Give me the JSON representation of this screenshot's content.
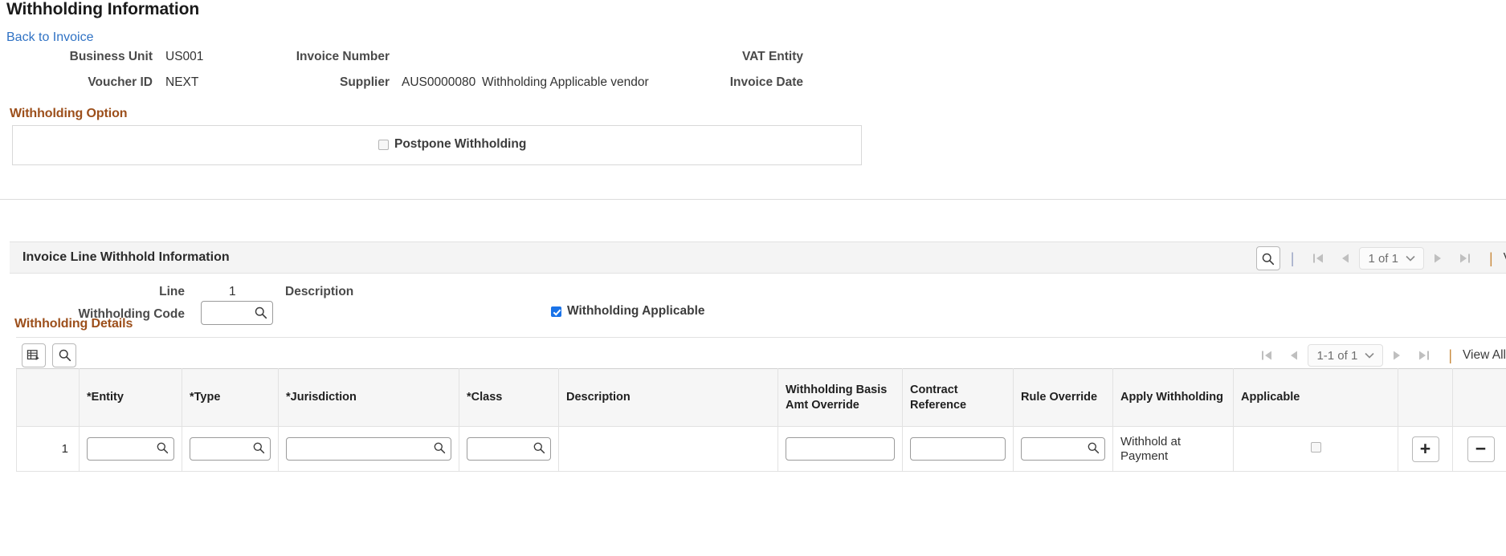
{
  "header": {
    "title": "Withholding Information",
    "back_link": "Back to Invoice"
  },
  "summary": {
    "business_unit_label": "Business Unit",
    "business_unit_value": "US001",
    "voucher_id_label": "Voucher ID",
    "voucher_id_value": "NEXT",
    "invoice_number_label": "Invoice Number",
    "invoice_number_value": "",
    "supplier_label": "Supplier",
    "supplier_id": "AUS0000080",
    "supplier_name": "Withholding Applicable vendor",
    "vat_entity_label": "VAT Entity",
    "vat_entity_value": "",
    "invoice_date_label": "Invoice Date",
    "invoice_date_value": ""
  },
  "withholding_option": {
    "group_title": "Withholding Option",
    "postpone_label": "Postpone Withholding",
    "postpone_checked": false
  },
  "invoice_line_section": {
    "title": "Invoice Line Withhold Information",
    "pager": {
      "search_icon": "search-icon",
      "first_icon": "first-page-icon",
      "prev_icon": "previous-page-icon",
      "range": "1 of 1",
      "next_icon": "next-page-icon",
      "last_icon": "last-page-icon",
      "view_all": "V"
    },
    "line_label": "Line",
    "line_value": "1",
    "description_label": "Description",
    "description_value": "",
    "withholding_code_label": "Withholding Code",
    "withholding_code_value": "",
    "withholding_applicable_label": "Withholding Applicable",
    "withholding_applicable_checked": true
  },
  "withholding_details": {
    "group_title": "Withholding Details",
    "toolbar": {
      "personalize_icon": "grid-personalize-icon",
      "find_icon": "search-icon"
    },
    "pager": {
      "first_icon": "first-page-icon",
      "prev_icon": "previous-page-icon",
      "range": "1-1 of 1",
      "next_icon": "next-page-icon",
      "last_icon": "last-page-icon",
      "view_all": "View All"
    },
    "columns": [
      "",
      "*Entity",
      "*Type",
      "*Jurisdiction",
      "*Class",
      "Description",
      "Withholding Basis Amt Override",
      "Contract Reference",
      "Rule Override",
      "Apply Withholding",
      "Applicable",
      "",
      ""
    ],
    "rows": [
      {
        "num": "1",
        "entity": "",
        "type": "",
        "jurisdiction": "",
        "class": "",
        "description": "",
        "basis_amt_override": "",
        "contract_reference": "",
        "rule_override": "",
        "apply_withholding": "Withhold at Payment",
        "applicable_checked": false,
        "add_label": "+",
        "remove_label": "−"
      }
    ]
  },
  "colors": {
    "group_heading": "#9c4f1b",
    "link": "#2f72c4",
    "checkbox_checked": "#1a73e8",
    "section_bar": "#f4f4f4"
  }
}
